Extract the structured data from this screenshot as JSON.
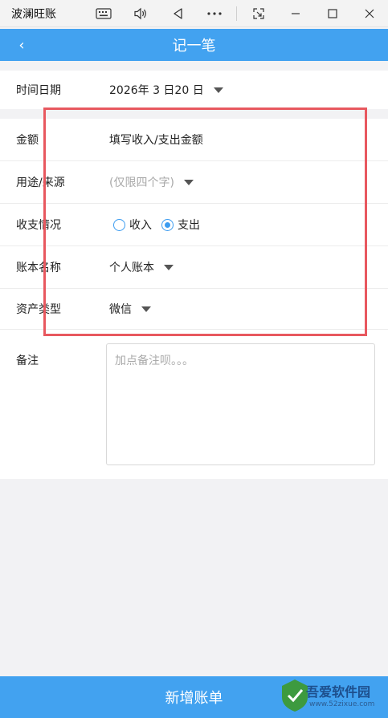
{
  "window": {
    "title": "波澜旺账",
    "icons": [
      "keyboard-icon",
      "volume-icon",
      "back-triangle-icon",
      "more-icon",
      "screenshot-icon",
      "minimize-icon",
      "maximize-icon",
      "close-icon"
    ]
  },
  "header": {
    "back_glyph": "‹",
    "title": "记一笔"
  },
  "form": {
    "date": {
      "label": "时间日期",
      "value": "2026年 3 日20 日"
    },
    "amount": {
      "label": "金额",
      "placeholder": "填写收入/支出金额"
    },
    "purpose": {
      "label": "用途/来源",
      "placeholder": "(仅限四个字)"
    },
    "type": {
      "label": "收支情况",
      "options": [
        {
          "label": "收入",
          "checked": false
        },
        {
          "label": "支出",
          "checked": true
        }
      ]
    },
    "account": {
      "label": "账本名称",
      "value": "个人账本"
    },
    "asset": {
      "label": "资产类型",
      "value": "微信"
    },
    "note": {
      "label": "备注",
      "placeholder": "加点备注呗。。。"
    }
  },
  "submit": {
    "label": "新增账单"
  },
  "watermark": {
    "brand": "吾爱软件园",
    "url": "www.52zixue.com"
  },
  "colors": {
    "accent": "#42a2f0",
    "highlight": "#e8585f",
    "radio": "#3c9cf0"
  }
}
